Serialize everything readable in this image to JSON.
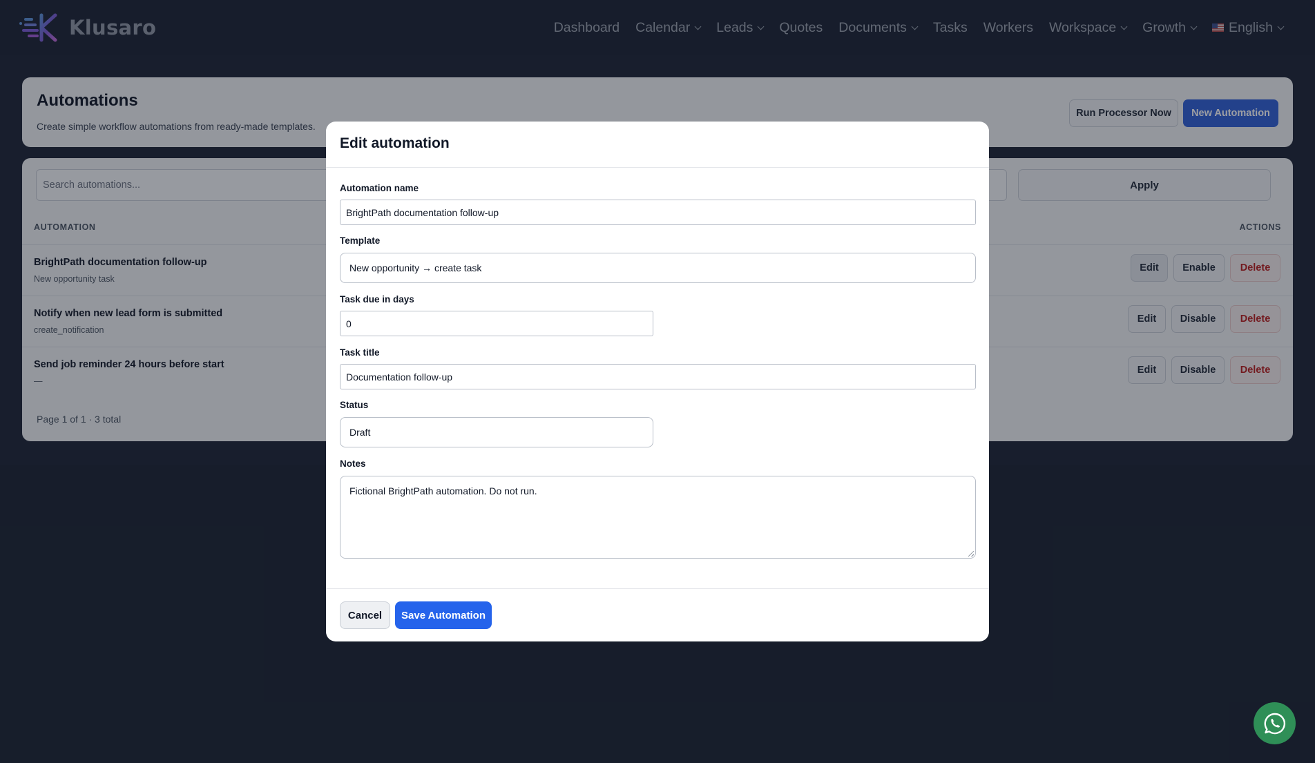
{
  "app": {
    "brand": "Klusaro",
    "accent_color": "#2563eb",
    "whatsapp_color": "#2f8f57"
  },
  "nav": {
    "items": [
      {
        "label": "Dashboard",
        "dropdown": false
      },
      {
        "label": "Calendar",
        "dropdown": true
      },
      {
        "label": "Leads",
        "dropdown": true
      },
      {
        "label": "Quotes",
        "dropdown": false
      },
      {
        "label": "Documents",
        "dropdown": true
      },
      {
        "label": "Tasks",
        "dropdown": false
      },
      {
        "label": "Workers",
        "dropdown": false
      },
      {
        "label": "Workspace",
        "dropdown": true
      },
      {
        "label": "Growth",
        "dropdown": true
      }
    ],
    "language": {
      "label": "English",
      "flag_icon": "us-flag-icon"
    }
  },
  "page": {
    "title": "Automations",
    "subtitle": "Create simple workflow automations from ready-made templates.",
    "run_button": "Run Processor Now",
    "new_button": "New Automation"
  },
  "list": {
    "search_placeholder": "Search automations...",
    "apply_label": "Apply",
    "col_automation": "AUTOMATION",
    "col_actions": "ACTIONS",
    "rows": [
      {
        "name": "BrightPath documentation follow-up",
        "sub": "New opportunity task",
        "edit": "Edit",
        "toggle": "Enable",
        "delete": "Delete"
      },
      {
        "name": "Notify when new lead form is submitted",
        "sub": "create_notification",
        "edit": "Edit",
        "toggle": "Disable",
        "delete": "Delete"
      },
      {
        "name": "Send job reminder 24 hours before start",
        "sub": "—",
        "edit": "Edit",
        "toggle": "Disable",
        "delete": "Delete"
      }
    ],
    "pagination": "Page 1 of 1 · 3 total"
  },
  "modal": {
    "title": "Edit automation",
    "fields": {
      "name_label": "Automation name",
      "name_value": "BrightPath documentation follow-up",
      "template_label": "Template",
      "template_value": "New opportunity → create task",
      "due_label": "Task due in days",
      "due_value": "0",
      "task_title_label": "Task title",
      "task_title_value": "Documentation follow-up",
      "status_label": "Status",
      "status_value": "Draft",
      "notes_label": "Notes",
      "notes_value": "Fictional BrightPath automation. Do not run."
    },
    "cancel_label": "Cancel",
    "save_label": "Save Automation"
  }
}
